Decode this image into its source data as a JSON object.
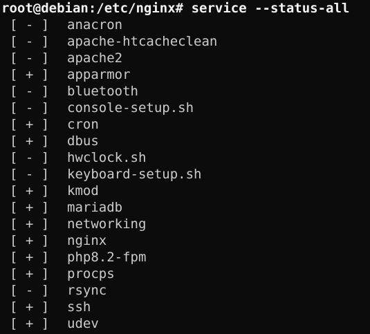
{
  "terminal": {
    "prompt": "root@debian:/etc/nginx#",
    "command": "service --status-all",
    "services": [
      {
        "status": "[ - ]",
        "name": "anacron"
      },
      {
        "status": "[ - ]",
        "name": "apache-htcacheclean"
      },
      {
        "status": "[ - ]",
        "name": "apache2"
      },
      {
        "status": "[ + ]",
        "name": "apparmor"
      },
      {
        "status": "[ - ]",
        "name": "bluetooth"
      },
      {
        "status": "[ - ]",
        "name": "console-setup.sh"
      },
      {
        "status": "[ + ]",
        "name": "cron"
      },
      {
        "status": "[ + ]",
        "name": "dbus"
      },
      {
        "status": "[ - ]",
        "name": "hwclock.sh"
      },
      {
        "status": "[ - ]",
        "name": "keyboard-setup.sh"
      },
      {
        "status": "[ + ]",
        "name": "kmod"
      },
      {
        "status": "[ + ]",
        "name": "mariadb"
      },
      {
        "status": "[ + ]",
        "name": "networking"
      },
      {
        "status": "[ + ]",
        "name": "nginx"
      },
      {
        "status": "[ + ]",
        "name": "php8.2-fpm"
      },
      {
        "status": "[ + ]",
        "name": "procps"
      },
      {
        "status": "[ - ]",
        "name": "rsync"
      },
      {
        "status": "[ + ]",
        "name": "ssh"
      },
      {
        "status": "[ + ]",
        "name": "udev"
      }
    ]
  },
  "colors": {
    "background": "#0c0c0c",
    "text": "#cccccc",
    "prompt": "#f2f2f2"
  }
}
